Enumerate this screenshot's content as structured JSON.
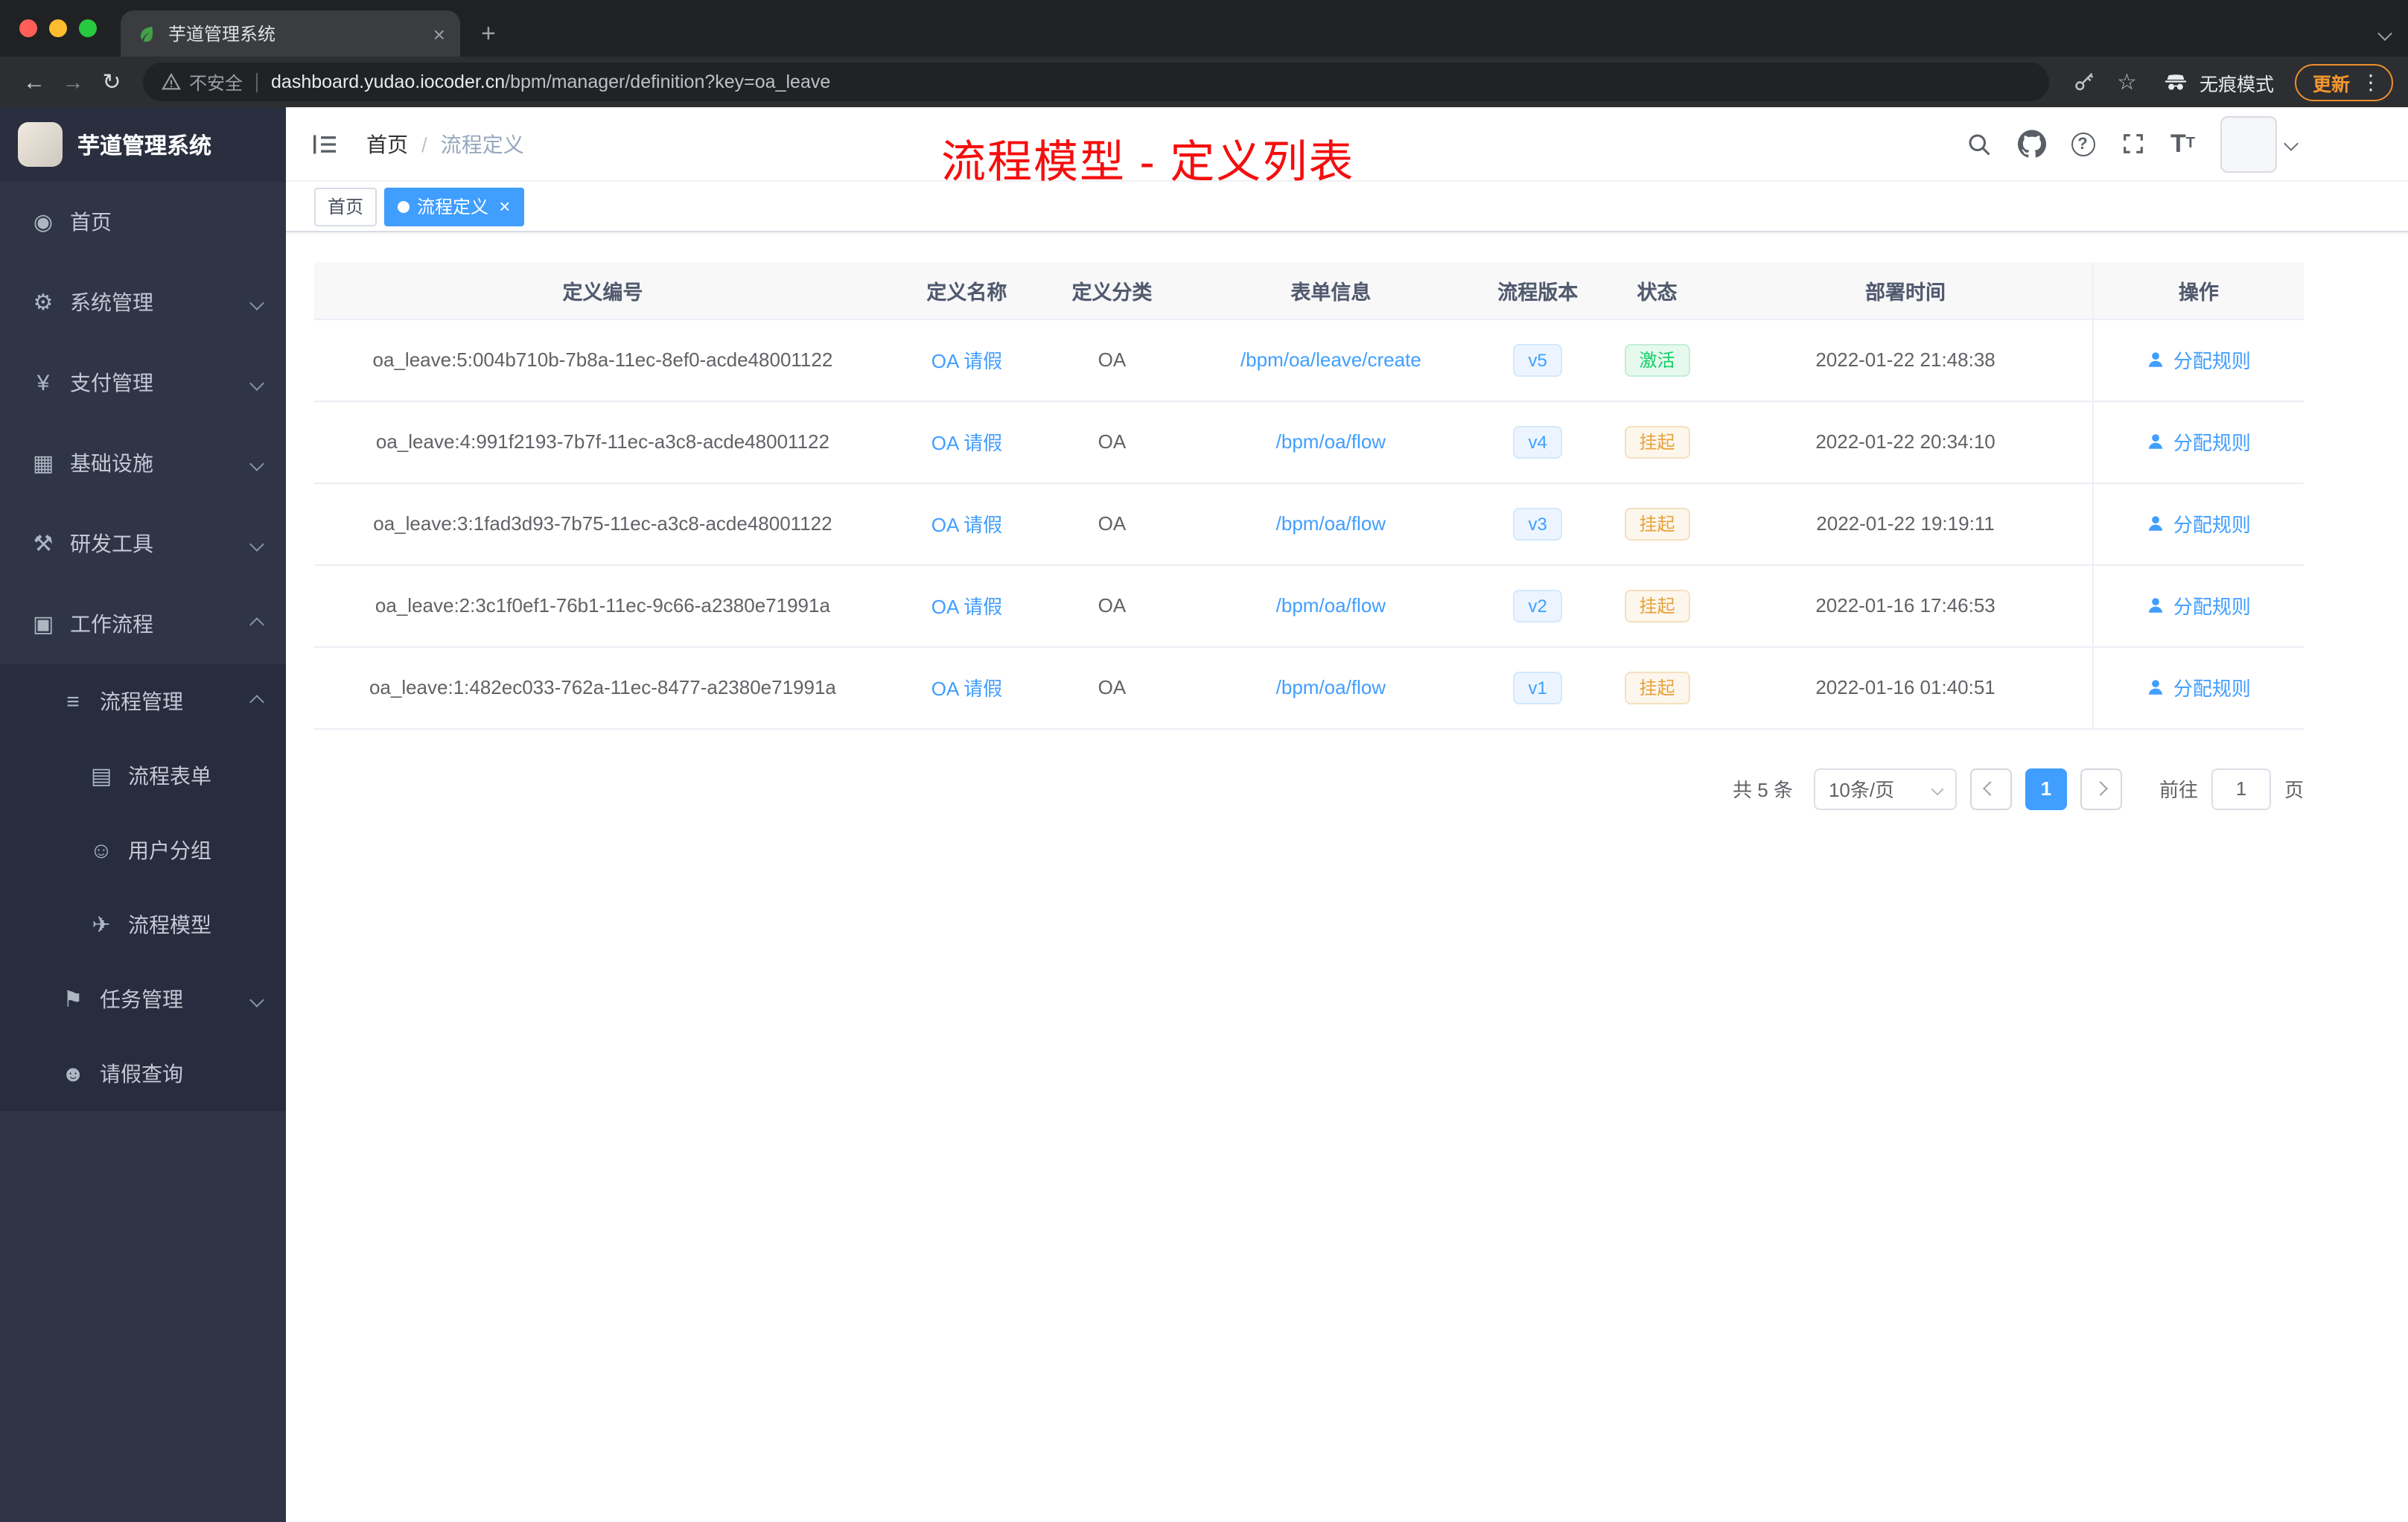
{
  "browser": {
    "tab_title": "芋道管理系统",
    "security_label": "不安全",
    "url_domain": "dashboard.yudao.iocoder.cn",
    "url_path": "/bpm/manager/definition?key=oa_leave",
    "incognito_label": "无痕模式",
    "update_label": "更新"
  },
  "glyphs": {
    "plus": "+",
    "dots": "⋮",
    "star": "☆",
    "back": "←",
    "forward": "→",
    "reload": "↻",
    "close": "×",
    "help": "?",
    "size_large": "T",
    "size_small": "T"
  },
  "sidebar": {
    "logo_title": "芋道管理系统",
    "items": [
      {
        "key": "home",
        "label": "首页",
        "icon": "dashboard-icon",
        "glyph": "◉",
        "level": 1,
        "arrow": null,
        "dark": false
      },
      {
        "key": "system",
        "label": "系统管理",
        "icon": "gear-icon",
        "glyph": "⚙",
        "level": 1,
        "arrow": "down",
        "dark": false
      },
      {
        "key": "payment",
        "label": "支付管理",
        "icon": "yen-icon",
        "glyph": "¥",
        "level": 1,
        "arrow": "down",
        "dark": false
      },
      {
        "key": "infrastructure",
        "label": "基础设施",
        "icon": "infrastructure-icon",
        "glyph": "▦",
        "level": 1,
        "arrow": "down",
        "dark": false
      },
      {
        "key": "devtools",
        "label": "研发工具",
        "icon": "tools-icon",
        "glyph": "⚒",
        "level": 1,
        "arrow": "down",
        "dark": false
      },
      {
        "key": "workflow",
        "label": "工作流程",
        "icon": "briefcase-icon",
        "glyph": "▣",
        "level": 1,
        "arrow": "up",
        "dark": false
      },
      {
        "key": "process-management",
        "label": "流程管理",
        "icon": "list-icon",
        "glyph": "≡",
        "level": 2,
        "arrow": "up",
        "dark": true
      },
      {
        "key": "process-form",
        "label": "流程表单",
        "icon": "form-icon",
        "glyph": "▤",
        "level": 3,
        "arrow": null,
        "dark": true
      },
      {
        "key": "user-group",
        "label": "用户分组",
        "icon": "users-icon",
        "glyph": "☺",
        "level": 3,
        "arrow": null,
        "dark": true
      },
      {
        "key": "process-model",
        "label": "流程模型",
        "icon": "send-icon",
        "glyph": "✈",
        "level": 3,
        "arrow": null,
        "dark": true
      },
      {
        "key": "task-management",
        "label": "任务管理",
        "icon": "tasks-icon",
        "glyph": "⚑",
        "level": 2,
        "arrow": "down",
        "dark": true
      },
      {
        "key": "leave-query",
        "label": "请假查询",
        "icon": "user-icon",
        "glyph": "☻",
        "level": 2,
        "arrow": null,
        "dark": true
      }
    ]
  },
  "header": {
    "breadcrumb": [
      "首页",
      "流程定义"
    ],
    "annotation": "流程模型 - 定义列表",
    "icons": [
      "search-icon",
      "github-icon",
      "help-icon",
      "fullscreen-icon",
      "font-size-icon"
    ]
  },
  "tags_view": {
    "tags": [
      {
        "label": "首页",
        "active": false,
        "closable": false
      },
      {
        "label": "流程定义",
        "active": true,
        "closable": true
      }
    ]
  },
  "table": {
    "columns": [
      "定义编号",
      "定义名称",
      "定义分类",
      "表单信息",
      "流程版本",
      "状态",
      "部署时间",
      "操作"
    ],
    "action_label": "分配规则",
    "rows": [
      {
        "id": "oa_leave:5:004b710b-7b8a-11ec-8ef0-acde48001122",
        "name": "OA 请假",
        "category": "OA",
        "form": "/bpm/oa/leave/create",
        "version": "v5",
        "status": "激活",
        "status_type": "success",
        "deploy_time": "2022-01-22 21:48:38"
      },
      {
        "id": "oa_leave:4:991f2193-7b7f-11ec-a3c8-acde48001122",
        "name": "OA 请假",
        "category": "OA",
        "form": "/bpm/oa/flow",
        "version": "v4",
        "status": "挂起",
        "status_type": "warning",
        "deploy_time": "2022-01-22 20:34:10"
      },
      {
        "id": "oa_leave:3:1fad3d93-7b75-11ec-a3c8-acde48001122",
        "name": "OA 请假",
        "category": "OA",
        "form": "/bpm/oa/flow",
        "version": "v3",
        "status": "挂起",
        "status_type": "warning",
        "deploy_time": "2022-01-22 19:19:11"
      },
      {
        "id": "oa_leave:2:3c1f0ef1-76b1-11ec-9c66-a2380e71991a",
        "name": "OA 请假",
        "category": "OA",
        "form": "/bpm/oa/flow",
        "version": "v2",
        "status": "挂起",
        "status_type": "warning",
        "deploy_time": "2022-01-16 17:46:53"
      },
      {
        "id": "oa_leave:1:482ec033-762a-11ec-8477-a2380e71991a",
        "name": "OA 请假",
        "category": "OA",
        "form": "/bpm/oa/flow",
        "version": "v1",
        "status": "挂起",
        "status_type": "warning",
        "deploy_time": "2022-01-16 01:40:51"
      }
    ]
  },
  "pagination": {
    "total_label": "共 5 条",
    "page_size": "10条/页",
    "current_page": "1",
    "goto_label": "前往",
    "goto_value": "1",
    "page_unit": "页"
  },
  "colors": {
    "accent_blue": "#409eff",
    "success_green": "#13ce66",
    "warning_orange": "#e6a23c",
    "annotation_red": "#f50e0e",
    "sidebar_bg": "#2f3447",
    "submenu_bg": "#272c3e",
    "update_orange": "#ee8f2d"
  }
}
